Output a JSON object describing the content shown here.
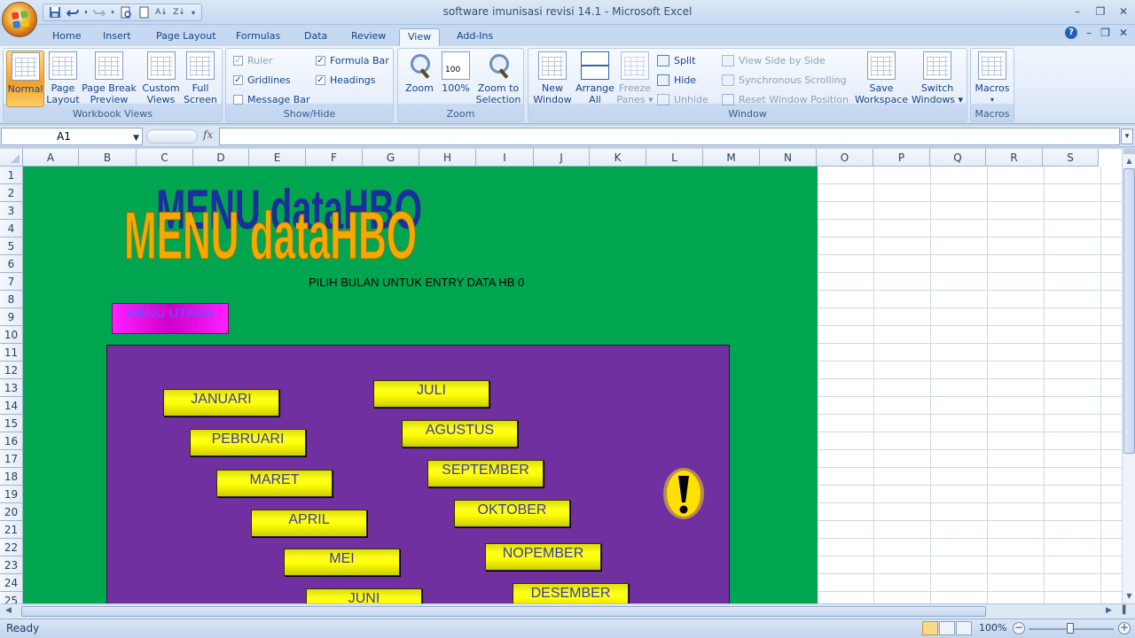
{
  "window": {
    "title": "software imunisasi revisi 14.1  -  Microsoft Excel"
  },
  "tabs": [
    "Home",
    "Insert",
    "Page Layout",
    "Formulas",
    "Data",
    "Review",
    "View",
    "Add-Ins"
  ],
  "active_tab": "View",
  "ribbon": {
    "workbook_views": {
      "label": "Workbook Views",
      "normal": "Normal",
      "page_layout_1": "Page",
      "page_layout_2": "Layout",
      "page_break_1": "Page Break",
      "page_break_2": "Preview",
      "custom_views_1": "Custom",
      "custom_views_2": "Views",
      "full_screen_1": "Full",
      "full_screen_2": "Screen"
    },
    "show_hide": {
      "label": "Show/Hide",
      "ruler": "Ruler",
      "gridlines": "Gridlines",
      "message_bar": "Message Bar",
      "formula_bar": "Formula Bar",
      "headings": "Headings",
      "check": "✓"
    },
    "zoom": {
      "label": "Zoom",
      "zoom_btn": "Zoom",
      "hundred": "100%",
      "zoom_sel_1": "Zoom to",
      "zoom_sel_2": "Selection",
      "hundred_icon": "100"
    },
    "window": {
      "label": "Window",
      "new_window_1": "New",
      "new_window_2": "Window",
      "arrange_1": "Arrange",
      "arrange_2": "All",
      "freeze_1": "Freeze",
      "freeze_2": "Panes ▾",
      "split": "Split",
      "hide": "Hide",
      "unhide": "Unhide",
      "side_by_side": "View Side by Side",
      "sync_scroll": "Synchronous Scrolling",
      "reset_pos": "Reset Window Position",
      "save_ws_1": "Save",
      "save_ws_2": "Workspace",
      "switch_1": "Switch",
      "switch_2": "Windows ▾"
    },
    "macros": {
      "label": "Macros",
      "macros_btn": "Macros",
      "arrow": "▾"
    }
  },
  "formula_bar": {
    "name_box": "A1",
    "fx": "fx",
    "formula": ""
  },
  "columns": [
    "A",
    "B",
    "C",
    "D",
    "E",
    "F",
    "G",
    "H",
    "I",
    "J",
    "K",
    "L",
    "M",
    "N",
    "O",
    "P",
    "Q",
    "R",
    "S"
  ],
  "rows": [
    "1",
    "2",
    "3",
    "4",
    "5",
    "6",
    "7",
    "8",
    "9",
    "10",
    "11",
    "12",
    "13",
    "14",
    "15",
    "16",
    "17",
    "18",
    "19",
    "20",
    "21",
    "22",
    "23",
    "24",
    "25"
  ],
  "sheet": {
    "logo_text": "MENU dataHBO",
    "subtitle": "PILIH BULAN UNTUK ENTRY DATA HB 0",
    "menu_utama": "MENU UTAMA",
    "months": [
      "JANUARI",
      "PEBRUARI",
      "MARET",
      "APRIL",
      "MEI",
      "JUNI",
      "JULI",
      "AGUSTUS",
      "SEPTEMBER",
      "OKTOBER",
      "NOPEMBER",
      "DESEMBER"
    ],
    "colors": {
      "green_bg": "#00a64f",
      "purple_panel": "#7030a0",
      "month_button": "#ffff00",
      "menu_utama": "#ff20ff",
      "logo_fill": "#f5a800",
      "logo_shadow": "#1a2f9a"
    }
  },
  "status": {
    "text": "Ready",
    "zoom": "100%",
    "minus": "−",
    "plus": "+"
  },
  "icons": [
    "office-button",
    "save-icon",
    "undo-icon",
    "redo-icon",
    "print-preview-icon",
    "sort-asc-icon",
    "sort-desc-icon",
    "help-icon",
    "minimize-icon",
    "restore-icon",
    "close-icon",
    "warning-exclamation-icon"
  ]
}
